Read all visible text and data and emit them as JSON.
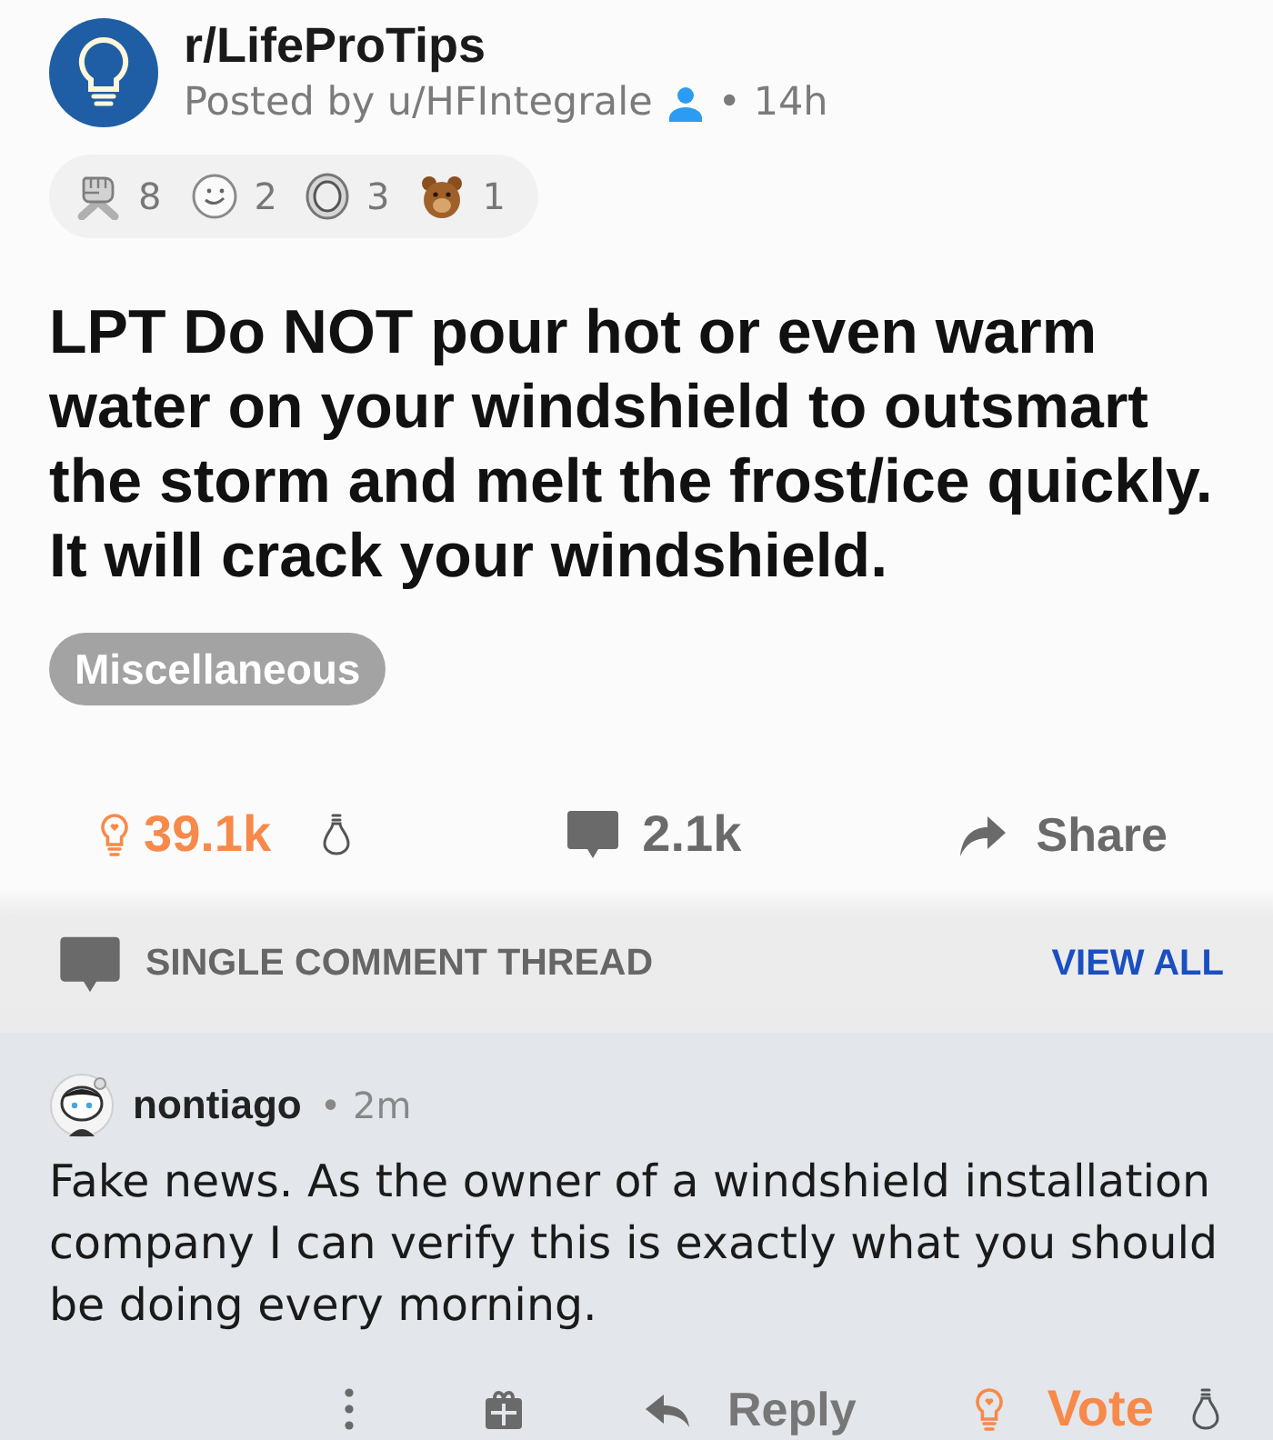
{
  "post": {
    "subreddit": "r/LifeProTips",
    "posted_by": "Posted by u/HFIntegrale",
    "time": "• 14h",
    "awards": [
      {
        "kind": "fist",
        "count": "8"
      },
      {
        "kind": "smiley",
        "count": "2"
      },
      {
        "kind": "coin",
        "count": "3"
      },
      {
        "kind": "bear",
        "count": "1"
      }
    ],
    "title": "LPT Do NOT pour hot or even warm water on your windshield to outsmart the storm and melt the frost/ice quickly. It will crack your windshield.",
    "flair": "Miscellaneous",
    "actions": {
      "votes": "39.1k",
      "upvoted": true,
      "comments": "2.1k",
      "share": "Share"
    }
  },
  "thread_bar": {
    "label": "SINGLE COMMENT THREAD",
    "link": "VIEW ALL"
  },
  "comment": {
    "author": "nontiago",
    "time": "• 2m",
    "body": "Fake news. As the owner of a windshield installation company I can verify this is exactly what you should be doing every morning.",
    "actions": {
      "reply": "Reply",
      "vote": "Vote",
      "upvoted": true
    }
  }
}
